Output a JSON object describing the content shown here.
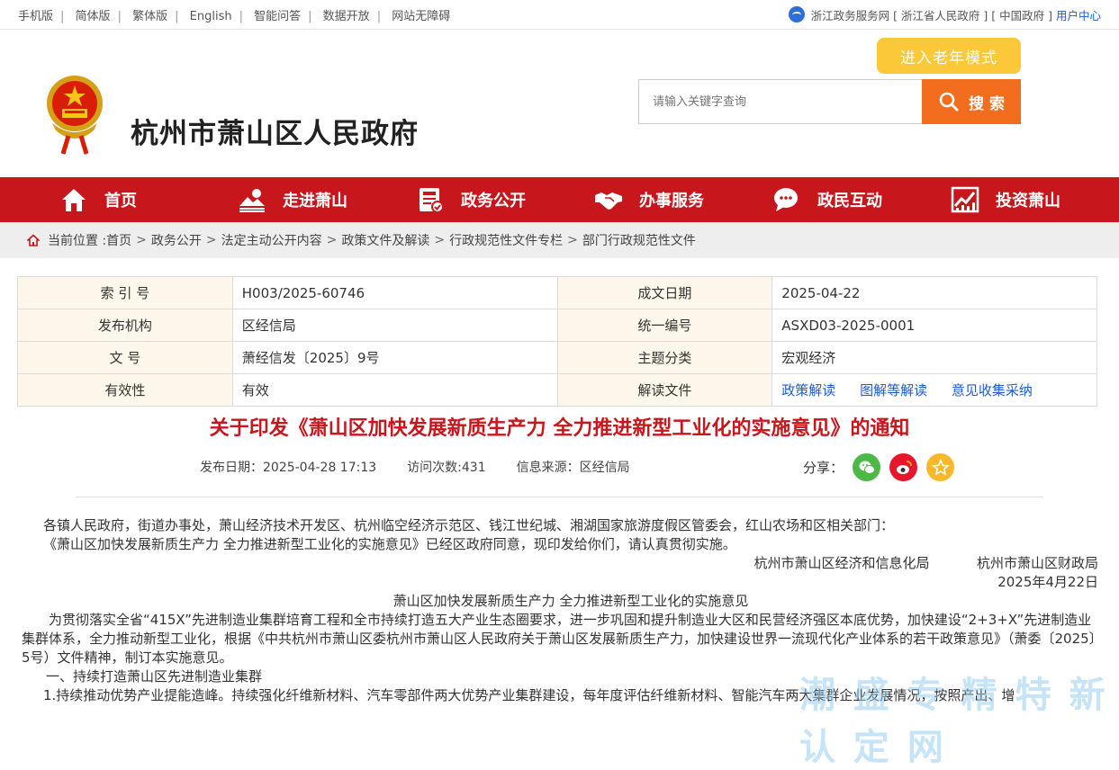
{
  "topbar": {
    "links": [
      "手机版",
      "简体版",
      "繁体版",
      "English",
      "智能问答",
      "数据开放",
      "网站无障碍"
    ],
    "right": {
      "zjzw": "浙江政务服务网",
      "zjgov": "[ 浙江省人民政府 ]",
      "china": "[ 中国政府 ]",
      "user_center": "用户中心"
    }
  },
  "header": {
    "title": "杭州市萧山区人民政府",
    "elder_mode": "进入老年模式",
    "search_placeholder": "请输入关键字查询",
    "search_label": "搜 索"
  },
  "nav": [
    {
      "label": "首页",
      "icon": "home-icon"
    },
    {
      "label": "走进萧山",
      "icon": "landscape-icon"
    },
    {
      "label": "政务公开",
      "icon": "document-icon"
    },
    {
      "label": "办事服务",
      "icon": "handshake-icon"
    },
    {
      "label": "政民互动",
      "icon": "chat-icon"
    },
    {
      "label": "投资萧山",
      "icon": "chart-icon"
    }
  ],
  "breadcrumb": {
    "prefix": "当前位置 :",
    "items": [
      "首页",
      "政务公开",
      "法定主动公开内容",
      "政策文件及解读",
      "行政规范性文件专栏",
      "部门行政规范性文件"
    ]
  },
  "info": {
    "index_k": "索 引 号",
    "index_v": "H003/2025-60746",
    "date_k": "成文日期",
    "date_v": "2025-04-22",
    "org_k": "发布机构",
    "org_v": "区经信局",
    "code_k": "统一编号",
    "code_v": "ASXD03-2025-0001",
    "docno_k": "文 号",
    "docno_v": "萧经信发〔2025〕9号",
    "topic_k": "主题分类",
    "topic_v": "宏观经济",
    "valid_k": "有效性",
    "valid_v": "有效",
    "interp_k": "解读文件",
    "interp_links": [
      "政策解读",
      "图解等解读",
      "意见收集采纳"
    ]
  },
  "article": {
    "title": "关于印发《萧山区加快发展新质生产力 全力推进新型工业化的实施意见》的通知",
    "publish_date": "发布日期：2025-04-28 17:13",
    "views": "访问次数:431",
    "source": "信息来源：区经信局",
    "share_label": "分享："
  },
  "body": {
    "p1": "各镇人民政府，街道办事处，萧山经济技术开发区、杭州临空经济示范区、钱江世纪城、湘湖国家旅游度假区管委会，红山农场和区相关部门：",
    "p2": "《萧山区加快发展新质生产力  全力推进新型工业化的实施意见》已经区政府同意，现印发给你们，请认真贯彻实施。",
    "sign1": "杭州市萧山区经济和信息化局",
    "sign2": "杭州市萧山区财政局",
    "sign_date": "2025年4月22日",
    "sub_title": "萧山区加快发展新质生产力  全力推进新型工业化的实施意见",
    "p3": "为贯彻落实全省“415X”先进制造业集群培育工程和全市持续打造五大产业生态圈要求，进一步巩固和提升制造业大区和民营经济强区本底优势，加快建设“2+3+X”先进制造业集群体系，全力推动新型工业化，根据《中共杭州市萧山区委杭州市萧山区人民政府关于萧山区发展新质生产力，加快建设世界一流现代化产业体系的若干政策意见》（萧委〔2025〕5号）文件精神，制订本实施意见。",
    "s1": "一、持续打造萧山区先进制造业集群",
    "p4": "1.持续推动优势产业提能造峰。持续强化纤维新材料、汽车零部件两大优势产业集群建设，每年度评估纤维新材料、智能汽车两大集群企业发展情况，按照产出、增"
  },
  "watermark": "潮 盛 专 精 特 新 认 定 网"
}
